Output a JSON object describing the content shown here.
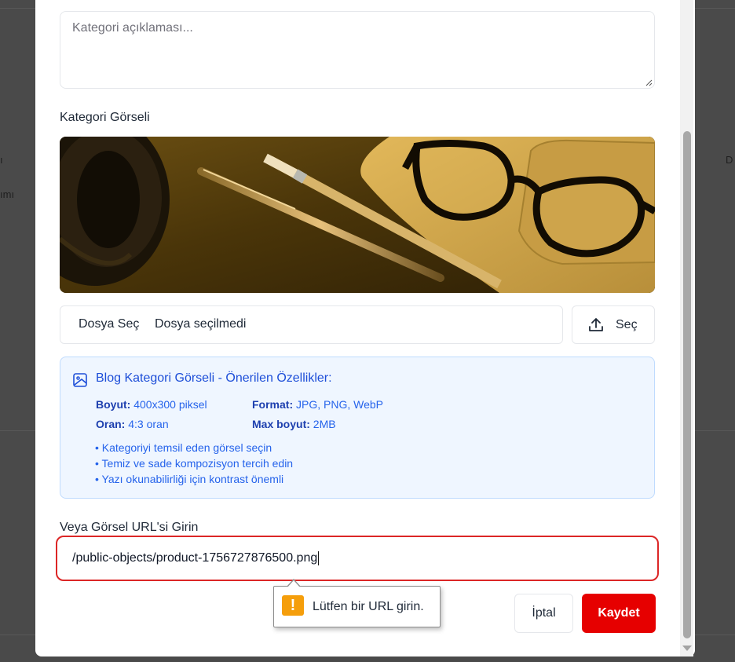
{
  "background": {
    "left_fragment_1": "ı",
    "left_fragment_2": "ımı",
    "right_fragment": "D"
  },
  "form": {
    "description_placeholder": "Kategori açıklaması...",
    "image_section_label": "Kategori Görseli",
    "file_input": {
      "button_label": "Dosya Seç",
      "status": "Dosya seçilmedi"
    },
    "select_button_label": "Seç",
    "info": {
      "title": "Blog Kategori Görseli - Önerilen Özellikler:",
      "size_label": "Boyut:",
      "size_value": "400x300 piksel",
      "format_label": "Format:",
      "format_value": "JPG, PNG, WebP",
      "ratio_label": "Oran:",
      "ratio_value": "4:3 oran",
      "max_size_label": "Max boyut:",
      "max_size_value": "2MB",
      "tips": [
        "• Kategoriyi temsil eden görsel seçin",
        "• Temiz ve sade kompozisyon tercih edin",
        "• Yazı okunabilirliği için kontrast önemli"
      ]
    },
    "url_label": "Veya Görsel URL'si Girin",
    "url_value": "/public-objects/product-1756727876500.png",
    "validation_message": "Lütfen bir URL girin.",
    "cancel_label": "İptal",
    "save_label": "Kaydet"
  },
  "colors": {
    "accent": "#e60000",
    "error_border": "#dc2626",
    "info_bg": "#eff6ff",
    "info_text": "#2563eb",
    "warning": "#f59e0b"
  },
  "icons": {
    "upload": "upload-icon",
    "image": "image-icon",
    "warning": "warning-icon",
    "resize": "resize-grip-icon"
  }
}
